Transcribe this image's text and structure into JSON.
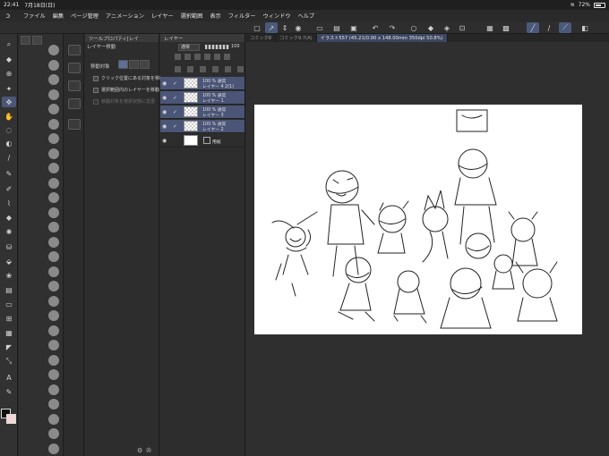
{
  "status": {
    "time": "22:41",
    "date": "7月18日(日)",
    "battery_label": "72%",
    "battery_level": 72
  },
  "menu": [
    "ファイル",
    "編集",
    "ページ管理",
    "アニメーション",
    "レイヤー",
    "選択範囲",
    "表示",
    "フィルター",
    "ウィンドウ",
    "ヘルプ"
  ],
  "tool_property": {
    "tab": "ツールプロパティ[レイ",
    "subtool": "レイヤー移動",
    "mode_label": "移動対象",
    "options": [
      {
        "label": "クリック位置にある対象を移動",
        "enabled": true
      },
      {
        "label": "選択範囲内のレイヤーを移動",
        "enabled": true
      },
      {
        "label": "移動対象を選択状態に変更",
        "enabled": false
      }
    ]
  },
  "layer_panel": {
    "tab": "レイヤー",
    "blend": "通常",
    "opacity": "100",
    "layers": [
      {
        "line1": "100 % 通常",
        "line2": "レイヤー 4 2(1)",
        "selected": true
      },
      {
        "line1": "100 % 通常",
        "line2": "レイヤー 1",
        "selected": true
      },
      {
        "line1": "100 % 通常",
        "line2": "レイヤー 3",
        "selected": true
      },
      {
        "line1": "100 % 通常",
        "line2": "レイヤー 2",
        "selected": true
      }
    ],
    "paper": {
      "name": "用紙"
    }
  },
  "canvas_tabs": [
    {
      "label": "コミック8",
      "active": false
    },
    {
      "label": "コミック9.7(A)",
      "active": false
    },
    {
      "label": "イラスト557 (45.21(0.00 x 148.00mm 350dpi 50.8%)",
      "active": true
    }
  ],
  "colors": {
    "accent": "#4b5a7a",
    "selected_layer": "#4b5577",
    "fg_color": "#111111",
    "bg_color": "#f3d6d6"
  }
}
